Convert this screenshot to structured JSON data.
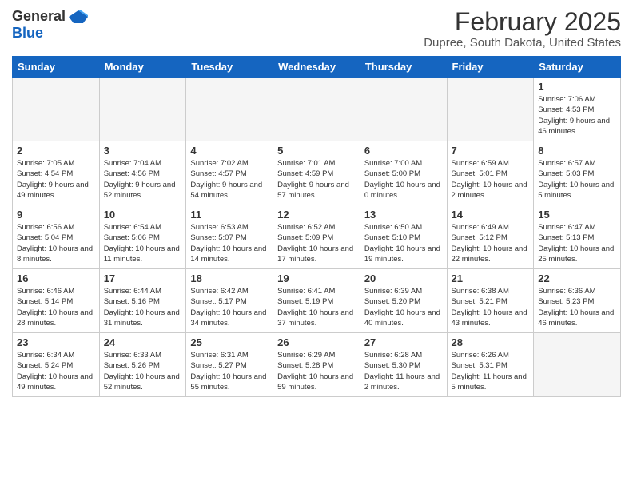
{
  "header": {
    "logo_general": "General",
    "logo_blue": "Blue",
    "month_title": "February 2025",
    "location": "Dupree, South Dakota, United States"
  },
  "days_of_week": [
    "Sunday",
    "Monday",
    "Tuesday",
    "Wednesday",
    "Thursday",
    "Friday",
    "Saturday"
  ],
  "weeks": [
    [
      {
        "day": "",
        "info": "",
        "empty": true
      },
      {
        "day": "",
        "info": "",
        "empty": true
      },
      {
        "day": "",
        "info": "",
        "empty": true
      },
      {
        "day": "",
        "info": "",
        "empty": true
      },
      {
        "day": "",
        "info": "",
        "empty": true
      },
      {
        "day": "",
        "info": "",
        "empty": true
      },
      {
        "day": "1",
        "info": "Sunrise: 7:06 AM\nSunset: 4:53 PM\nDaylight: 9 hours and 46 minutes."
      }
    ],
    [
      {
        "day": "2",
        "info": "Sunrise: 7:05 AM\nSunset: 4:54 PM\nDaylight: 9 hours and 49 minutes."
      },
      {
        "day": "3",
        "info": "Sunrise: 7:04 AM\nSunset: 4:56 PM\nDaylight: 9 hours and 52 minutes."
      },
      {
        "day": "4",
        "info": "Sunrise: 7:02 AM\nSunset: 4:57 PM\nDaylight: 9 hours and 54 minutes."
      },
      {
        "day": "5",
        "info": "Sunrise: 7:01 AM\nSunset: 4:59 PM\nDaylight: 9 hours and 57 minutes."
      },
      {
        "day": "6",
        "info": "Sunrise: 7:00 AM\nSunset: 5:00 PM\nDaylight: 10 hours and 0 minutes."
      },
      {
        "day": "7",
        "info": "Sunrise: 6:59 AM\nSunset: 5:01 PM\nDaylight: 10 hours and 2 minutes."
      },
      {
        "day": "8",
        "info": "Sunrise: 6:57 AM\nSunset: 5:03 PM\nDaylight: 10 hours and 5 minutes."
      }
    ],
    [
      {
        "day": "9",
        "info": "Sunrise: 6:56 AM\nSunset: 5:04 PM\nDaylight: 10 hours and 8 minutes."
      },
      {
        "day": "10",
        "info": "Sunrise: 6:54 AM\nSunset: 5:06 PM\nDaylight: 10 hours and 11 minutes."
      },
      {
        "day": "11",
        "info": "Sunrise: 6:53 AM\nSunset: 5:07 PM\nDaylight: 10 hours and 14 minutes."
      },
      {
        "day": "12",
        "info": "Sunrise: 6:52 AM\nSunset: 5:09 PM\nDaylight: 10 hours and 17 minutes."
      },
      {
        "day": "13",
        "info": "Sunrise: 6:50 AM\nSunset: 5:10 PM\nDaylight: 10 hours and 19 minutes."
      },
      {
        "day": "14",
        "info": "Sunrise: 6:49 AM\nSunset: 5:12 PM\nDaylight: 10 hours and 22 minutes."
      },
      {
        "day": "15",
        "info": "Sunrise: 6:47 AM\nSunset: 5:13 PM\nDaylight: 10 hours and 25 minutes."
      }
    ],
    [
      {
        "day": "16",
        "info": "Sunrise: 6:46 AM\nSunset: 5:14 PM\nDaylight: 10 hours and 28 minutes."
      },
      {
        "day": "17",
        "info": "Sunrise: 6:44 AM\nSunset: 5:16 PM\nDaylight: 10 hours and 31 minutes."
      },
      {
        "day": "18",
        "info": "Sunrise: 6:42 AM\nSunset: 5:17 PM\nDaylight: 10 hours and 34 minutes."
      },
      {
        "day": "19",
        "info": "Sunrise: 6:41 AM\nSunset: 5:19 PM\nDaylight: 10 hours and 37 minutes."
      },
      {
        "day": "20",
        "info": "Sunrise: 6:39 AM\nSunset: 5:20 PM\nDaylight: 10 hours and 40 minutes."
      },
      {
        "day": "21",
        "info": "Sunrise: 6:38 AM\nSunset: 5:21 PM\nDaylight: 10 hours and 43 minutes."
      },
      {
        "day": "22",
        "info": "Sunrise: 6:36 AM\nSunset: 5:23 PM\nDaylight: 10 hours and 46 minutes."
      }
    ],
    [
      {
        "day": "23",
        "info": "Sunrise: 6:34 AM\nSunset: 5:24 PM\nDaylight: 10 hours and 49 minutes."
      },
      {
        "day": "24",
        "info": "Sunrise: 6:33 AM\nSunset: 5:26 PM\nDaylight: 10 hours and 52 minutes."
      },
      {
        "day": "25",
        "info": "Sunrise: 6:31 AM\nSunset: 5:27 PM\nDaylight: 10 hours and 55 minutes."
      },
      {
        "day": "26",
        "info": "Sunrise: 6:29 AM\nSunset: 5:28 PM\nDaylight: 10 hours and 59 minutes."
      },
      {
        "day": "27",
        "info": "Sunrise: 6:28 AM\nSunset: 5:30 PM\nDaylight: 11 hours and 2 minutes."
      },
      {
        "day": "28",
        "info": "Sunrise: 6:26 AM\nSunset: 5:31 PM\nDaylight: 11 hours and 5 minutes."
      },
      {
        "day": "",
        "info": "",
        "empty": true
      }
    ]
  ]
}
